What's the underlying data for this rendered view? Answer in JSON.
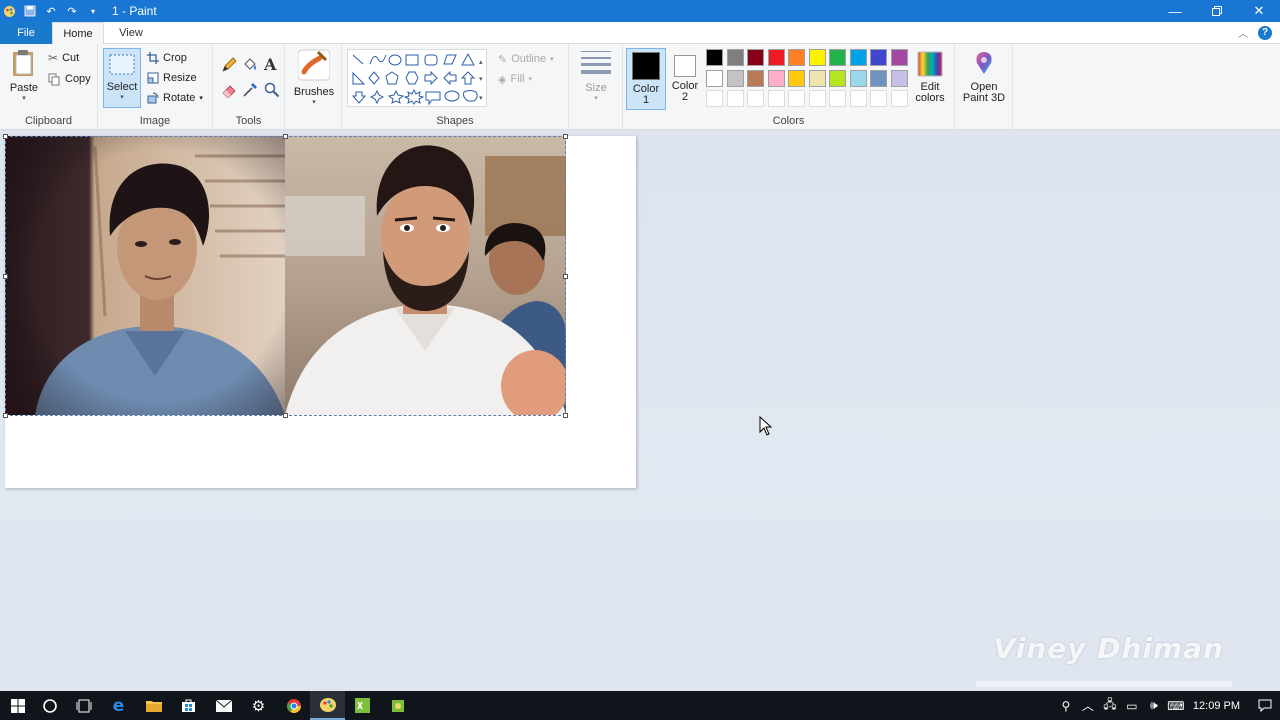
{
  "window": {
    "title": "1 - Paint",
    "controls": [
      "minimize-icon",
      "restore-icon",
      "close-icon"
    ]
  },
  "tabs": [
    {
      "label": "File"
    },
    {
      "label": "Home"
    },
    {
      "label": "View"
    }
  ],
  "ribbon": {
    "clipboard": {
      "label": "Clipboard",
      "paste": "Paste",
      "cut": "Cut",
      "copy": "Copy"
    },
    "image": {
      "label": "Image",
      "select": "Select",
      "crop": "Crop",
      "resize": "Resize",
      "rotate": "Rotate"
    },
    "tools": {
      "label": "Tools"
    },
    "brushes": {
      "label": "Brushes"
    },
    "shapes": {
      "label": "Shapes",
      "outline": "Outline",
      "fill": "Fill"
    },
    "size": {
      "label": "Size"
    },
    "colors": {
      "label": "Colors",
      "color1": "Color 1",
      "color2": "Color 2",
      "color1_value": "#000000",
      "color2_value": "#ffffff",
      "edit_colors": "Edit colors",
      "palette_row1": [
        "#000000",
        "#7f7f7f",
        "#880015",
        "#ed1c24",
        "#ff7f27",
        "#fff200",
        "#22b14c",
        "#00a2e8",
        "#3f48cc",
        "#a349a4"
      ],
      "palette_row2": [
        "#ffffff",
        "#c3c3c3",
        "#b97a57",
        "#ffaec9",
        "#ffc90e",
        "#efe4b0",
        "#b5e61d",
        "#99d9ea",
        "#7092be",
        "#c8bfe7"
      ]
    },
    "paint3d": {
      "label": "Open Paint 3D"
    }
  },
  "watermark": "Viney Dhiman",
  "taskbar": {
    "clock": "12:09 PM"
  }
}
